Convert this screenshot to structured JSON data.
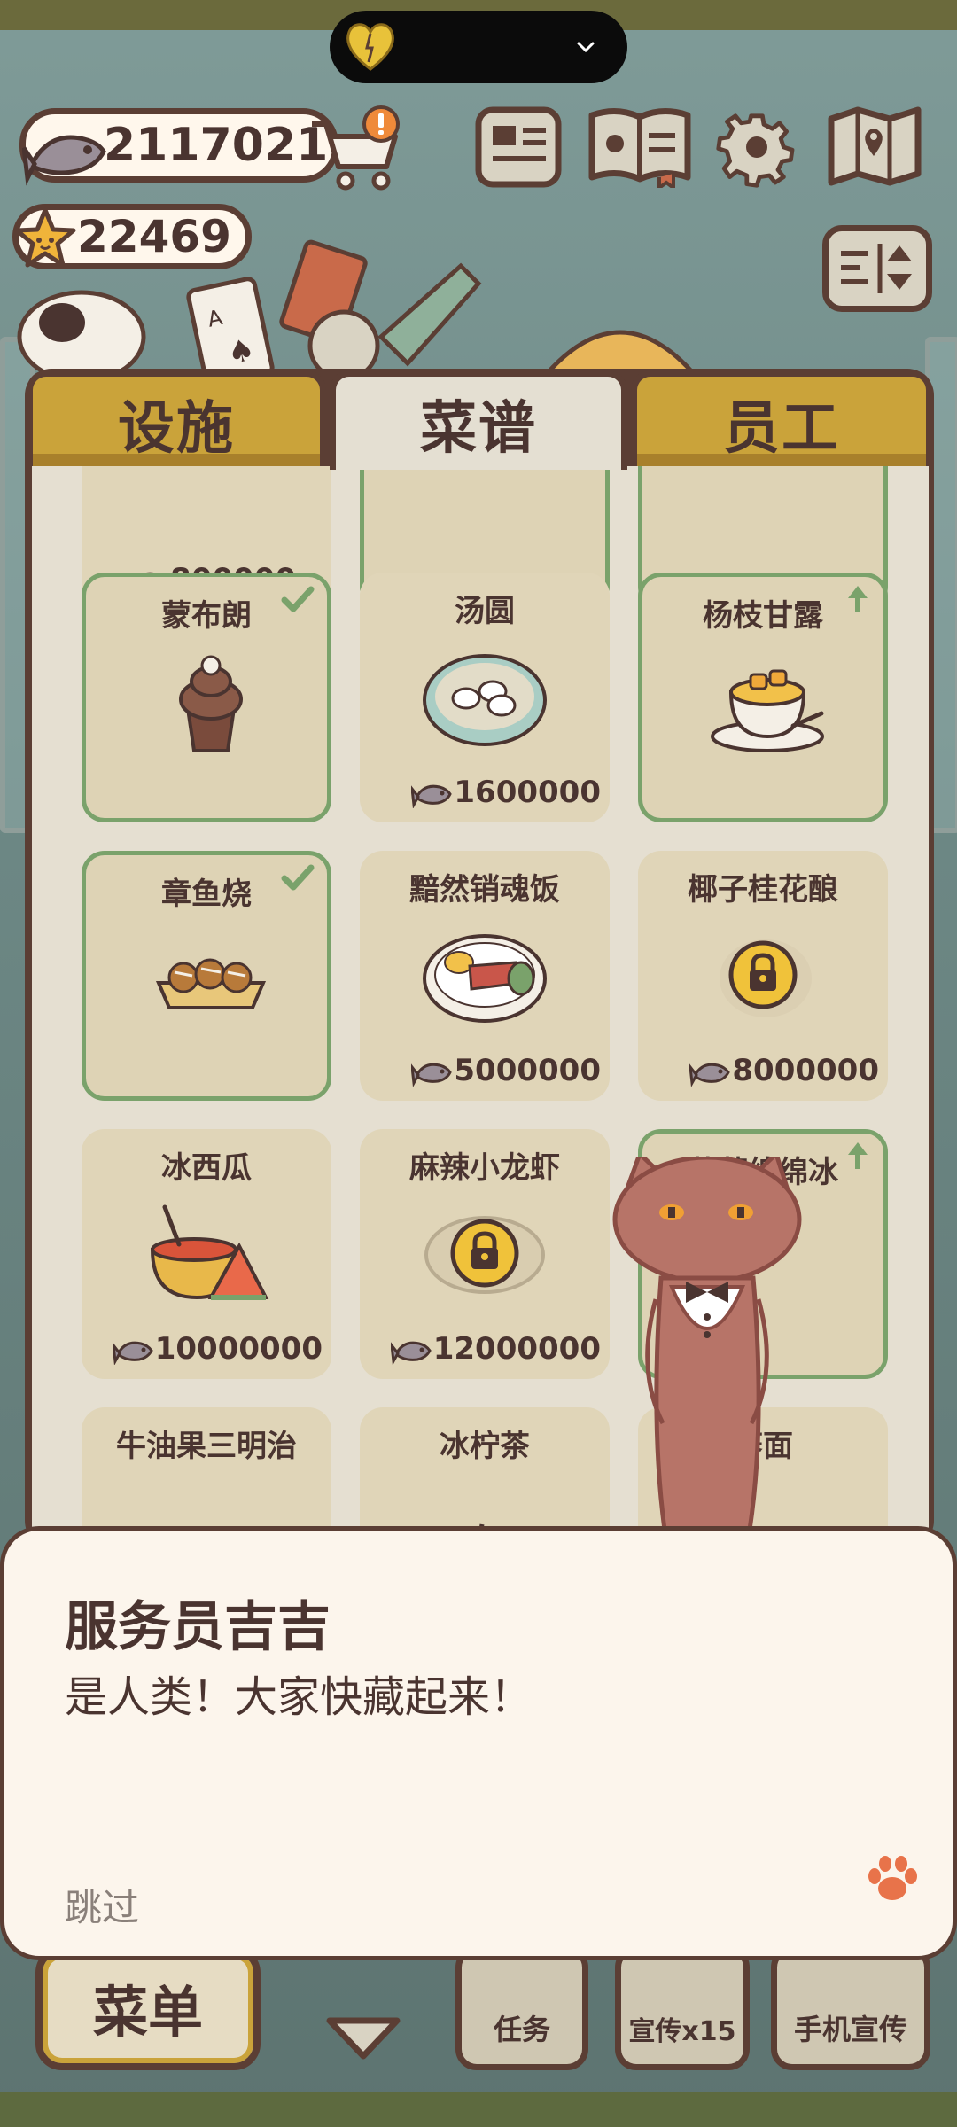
{
  "currency": {
    "fish": "2117021",
    "stars": "22469"
  },
  "tabs": [
    {
      "label": "设施",
      "active": false
    },
    {
      "label": "菜谱",
      "active": true
    },
    {
      "label": "员工",
      "active": false
    }
  ],
  "recipes": {
    "partial_top": [
      {
        "price": "800000"
      }
    ],
    "rows": [
      [
        {
          "name": "蒙布朗",
          "owned": true,
          "check": true
        },
        {
          "name": "汤圆",
          "owned": false,
          "price": "1600000"
        },
        {
          "name": "杨枝甘露",
          "owned": true,
          "upgrade": true
        }
      ],
      [
        {
          "name": "章鱼烧",
          "owned": true,
          "check": true
        },
        {
          "name": "黯然销魂饭",
          "owned": false,
          "price": "5000000"
        },
        {
          "name": "椰子桂花酿",
          "owned": false,
          "locked": true,
          "price": "8000000"
        }
      ],
      [
        {
          "name": "冰西瓜",
          "owned": false,
          "price": "10000000"
        },
        {
          "name": "麻辣小龙虾",
          "owned": false,
          "locked": true,
          "price": "12000000"
        },
        {
          "name": "草莓绵绵冰",
          "owned": true,
          "upgrade": true
        }
      ],
      [
        {
          "name": "牛油果三明治"
        },
        {
          "name": "冰柠茶"
        },
        {
          "name": "荞面"
        }
      ]
    ]
  },
  "bottom_bar": {
    "menu": "菜单",
    "tasks": "任务",
    "promo": "宣传x15",
    "phone_promo": "手机宣传"
  },
  "dialog": {
    "speaker": "服务员吉吉",
    "line": "是人类！大家快藏起来！",
    "skip": "跳过"
  },
  "colors": {
    "panel_border": "#5b3e34",
    "tab_gold": "#caa33a",
    "owned_border": "#7aa26b",
    "paw_orange": "#e8734a"
  }
}
